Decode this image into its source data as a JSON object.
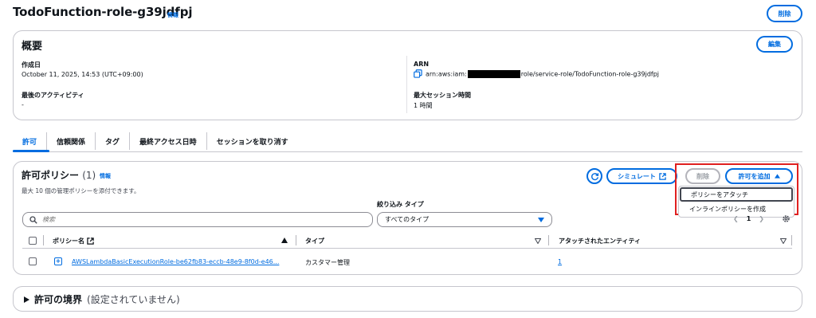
{
  "header": {
    "title": "TodoFunction-role-g39jdfpj",
    "info": "情報",
    "delete_label": "削除"
  },
  "overview": {
    "title": "概要",
    "edit_label": "編集",
    "created_label": "作成日",
    "created_value": "October 11, 2025, 14:53 (UTC+09:00)",
    "last_activity_label": "最後のアクティビティ",
    "last_activity_value": "-",
    "arn_label": "ARN",
    "arn_prefix": "arn:aws:iam:",
    "arn_suffix": "role/service-role/TodoFunction-role-g39jdfpj",
    "max_session_label": "最大セッション時間",
    "max_session_value": "1 時間"
  },
  "tabs": [
    "許可",
    "信頼関係",
    "タグ",
    "最終アクセス日時",
    "セッションを取り消す"
  ],
  "permissions": {
    "title": "許可ポリシー",
    "count": "(1)",
    "info": "情報",
    "description": "最大 10 個の管理ポリシーを添付できます。",
    "simulate_label": "シミュレート",
    "delete_label": "削除",
    "add_label": "許可を追加",
    "menu": {
      "attach": "ポリシーをアタッチ",
      "inline": "インラインポリシーを作成"
    },
    "filter_label": "絞り込み タイプ",
    "search_placeholder": "検索",
    "filter_value": "すべてのタイプ",
    "page": "1",
    "columns": {
      "name": "ポリシー名",
      "type": "タイプ",
      "entities": "アタッチされたエンティティ"
    },
    "rows": [
      {
        "name": "AWSLambdaBasicExecutionRole-be62fb83-eccb-48e9-8f0d-e46...",
        "type": "カスタマー管理",
        "entities": "1"
      }
    ]
  },
  "boundary": {
    "title": "許可の境界",
    "subtitle": "(設定されていません)"
  },
  "colors": {
    "accent": "#006ce0",
    "highlight": "#e02020"
  }
}
